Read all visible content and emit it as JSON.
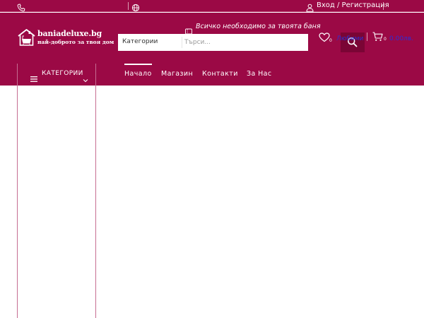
{
  "topbar": {
    "login_text": "Вход / Регистрация"
  },
  "icons": {
    "phone": "phone-icon",
    "globe": "globe-icon",
    "user": "user-icon",
    "promo": "ticket-icon",
    "search": "search-icon",
    "wishlist": "heart-icon",
    "cart": "cart-icon",
    "menu": "hamburger-icon",
    "chevron": "chevron-down-icon"
  },
  "logo": {
    "brand": "baniadeluxe.bg",
    "tagline": "най-доброто за твоя дом"
  },
  "promo": {
    "text": "Всичко необходимо за твоята баня"
  },
  "search": {
    "category_label": "Категории",
    "placeholder": "Търси..."
  },
  "wishlist": {
    "count": "0",
    "label": "Любими"
  },
  "cart": {
    "count": "0",
    "total": "0.00лв."
  },
  "nav": {
    "categories_label": "КАТЕГОРИИ",
    "links": [
      {
        "label": "Начало"
      },
      {
        "label": "Магазин"
      },
      {
        "label": "Контакти"
      },
      {
        "label": "За Нас"
      }
    ]
  },
  "colors": {
    "brand": "#9b0945",
    "brand_dark": "#7a0535",
    "link_blue": "#2b2fd6"
  }
}
